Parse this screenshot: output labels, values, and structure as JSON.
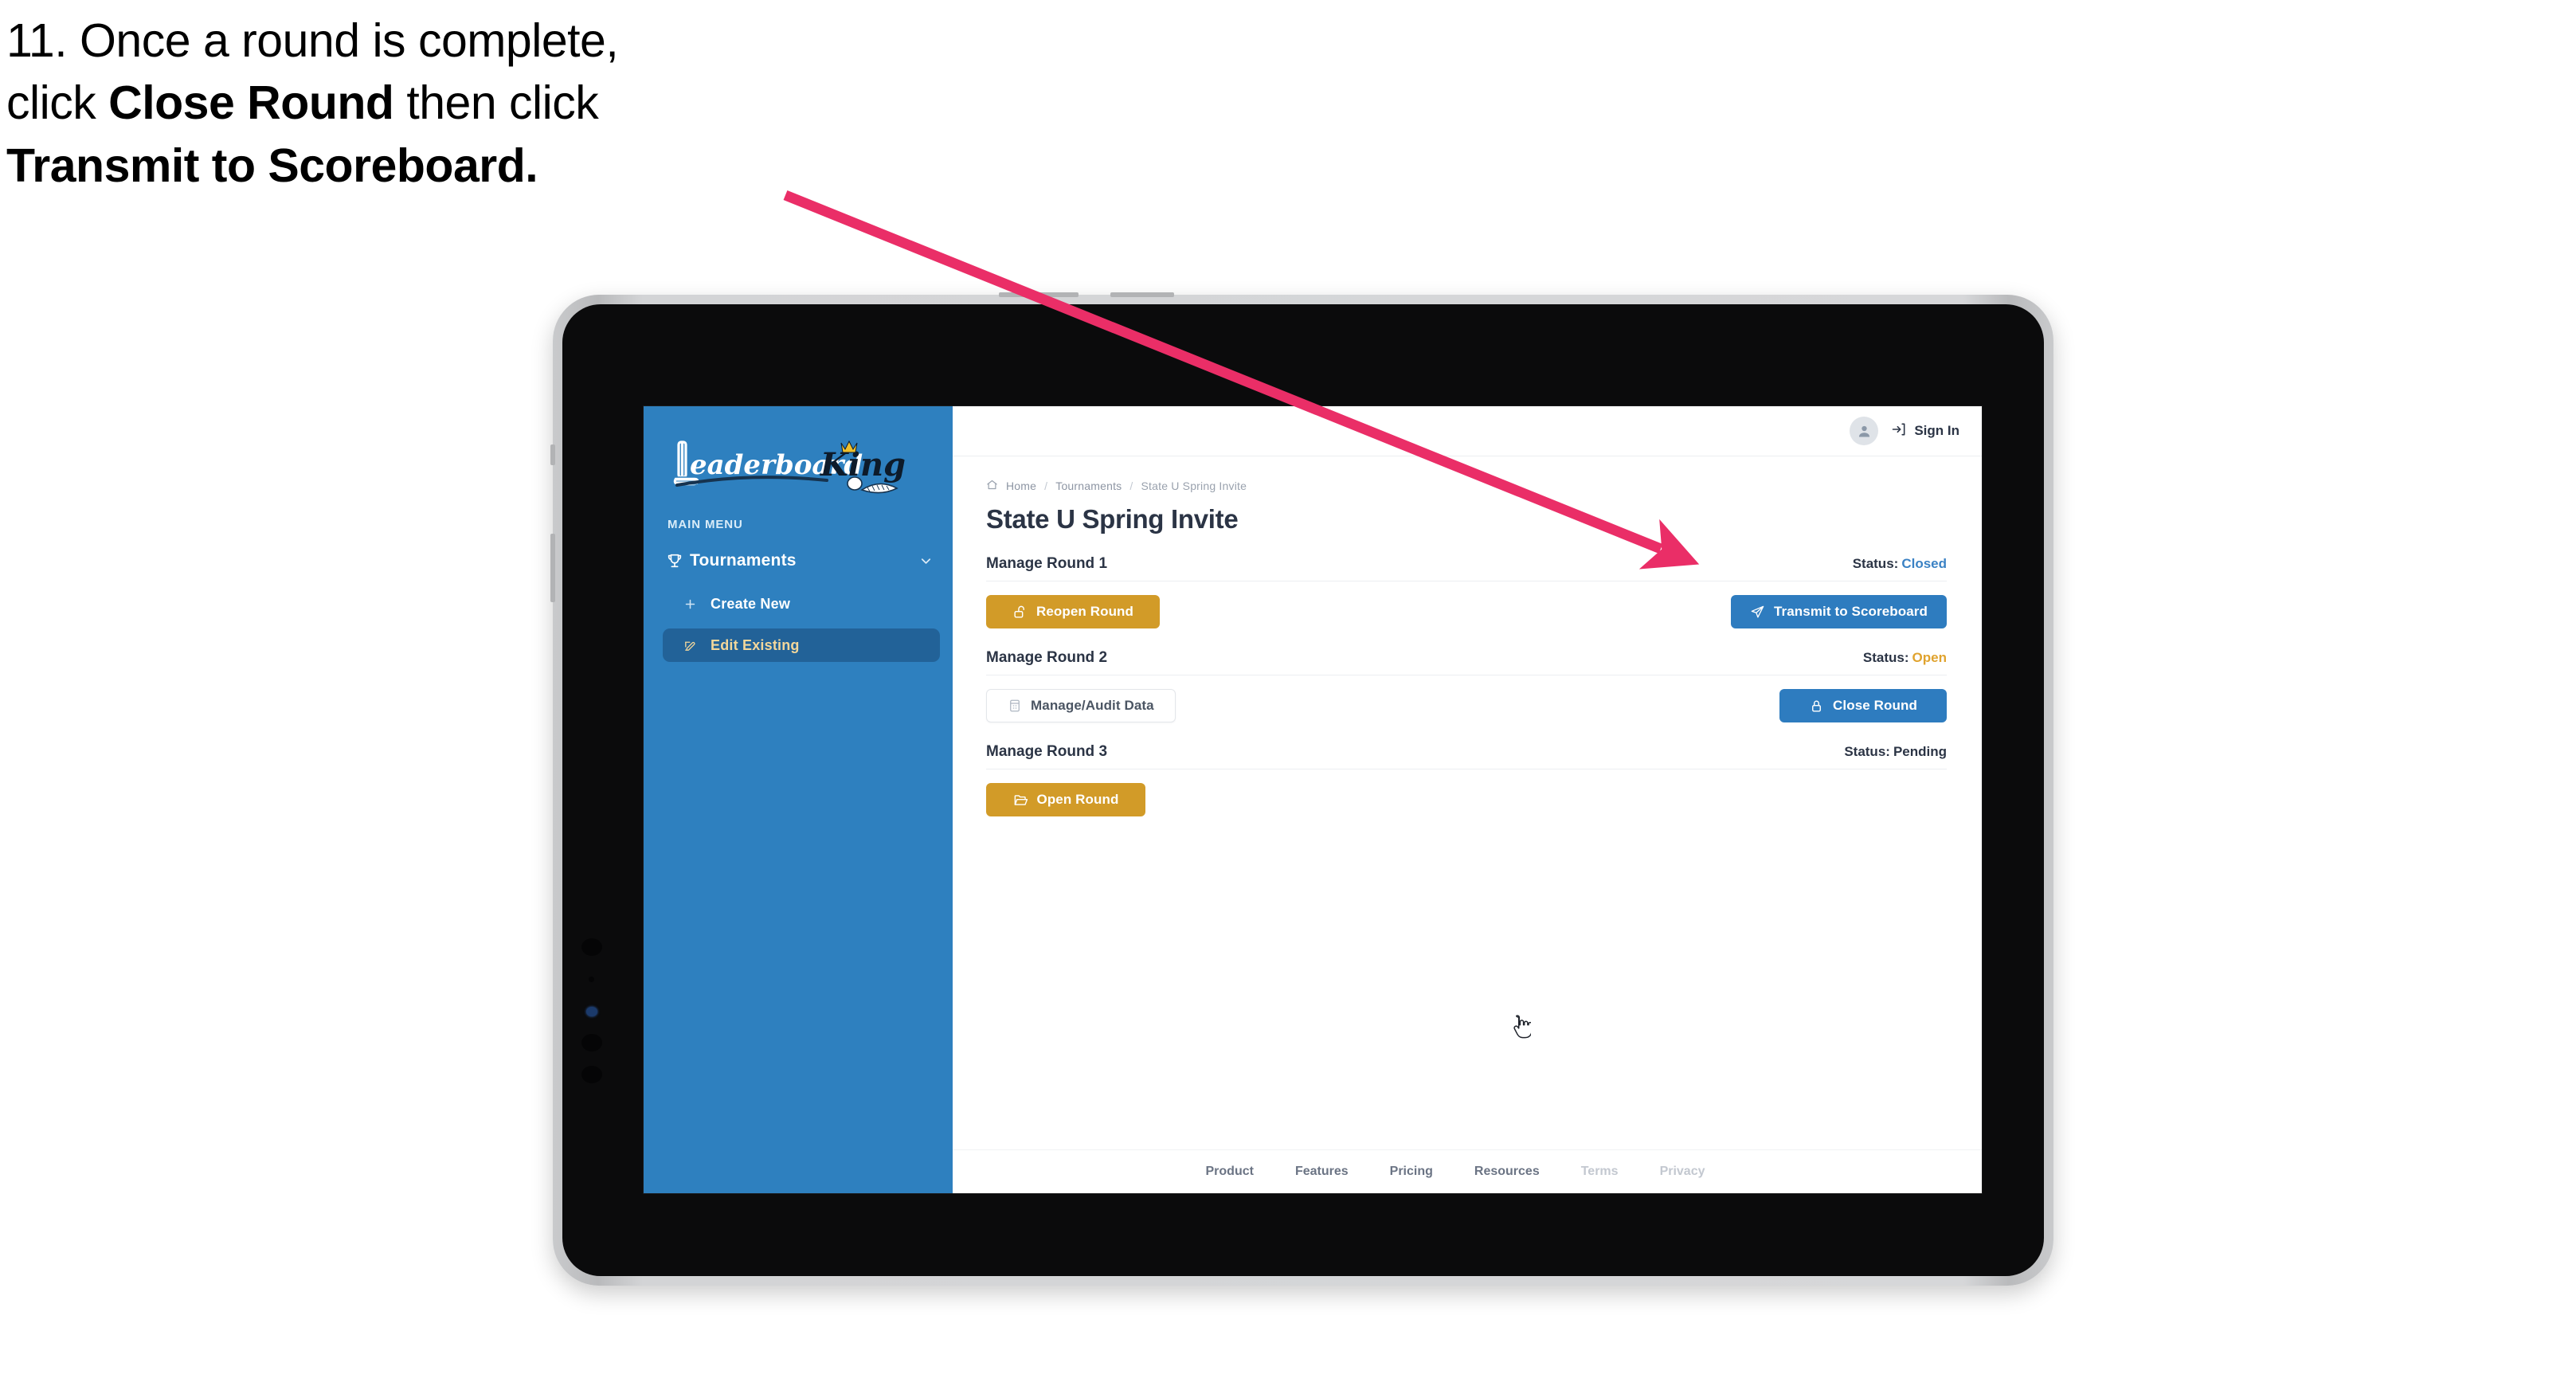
{
  "caption": {
    "line1_prefix": "11. Once a round is complete,",
    "line2_pre": "click ",
    "line2_bold": "Close Round",
    "line2_post": " then click",
    "line3_bold": "Transmit to Scoreboard."
  },
  "annotation": {
    "arrow_color": "#ea2e67",
    "arrow_name": "pointer-arrow-to-transmit-button"
  },
  "sidebar": {
    "logo": {
      "word_script": "Leaderboard",
      "word_bold": "King",
      "crown_color": "#f0c02c",
      "script_color": "#ffffff",
      "bold_color": "#0d1b2a"
    },
    "menu_label": "MAIN MENU",
    "items": [
      {
        "label": "Tournaments",
        "icon": "trophy-icon",
        "chevron": "chevron-down-icon",
        "active": false
      },
      {
        "label": "Create New",
        "icon": "plus-icon",
        "active": false
      },
      {
        "label": "Edit Existing",
        "icon": "edit-square-icon",
        "active": true
      }
    ],
    "bg_color": "#2e80bf",
    "active_bg_color": "#226298",
    "active_text_color": "#f3d79b"
  },
  "topbar": {
    "avatar_icon": "user-avatar-icon",
    "signin_icon": "login-arrow-icon",
    "signin_label": "Sign In"
  },
  "breadcrumb": {
    "home_icon": "home-icon",
    "items": [
      "Home",
      "Tournaments",
      "State U Spring Invite"
    ],
    "separator": "/"
  },
  "page": {
    "title": "State U Spring Invite"
  },
  "rounds": [
    {
      "title": "Manage Round 1",
      "status_label": "Status:",
      "status_value": "Closed",
      "status_color": "#3b82c4",
      "left_button": {
        "label": "Reopen Round",
        "icon": "unlock-icon",
        "style": "gold"
      },
      "right_button": {
        "label": "Transmit to Scoreboard",
        "icon": "paper-plane-icon",
        "style": "blue"
      }
    },
    {
      "title": "Manage Round 2",
      "status_label": "Status:",
      "status_value": "Open",
      "status_color": "#e0a32e",
      "left_button": {
        "label": "Manage/Audit Data",
        "icon": "table-grid-icon",
        "style": "ghost"
      },
      "right_button": {
        "label": "Close Round",
        "icon": "lock-icon",
        "style": "blue"
      }
    },
    {
      "title": "Manage Round 3",
      "status_label": "Status:",
      "status_value": "Pending",
      "status_color": "#2b3445",
      "left_button": {
        "label": "Open Round",
        "icon": "folder-open-icon",
        "style": "gold"
      },
      "right_button": null
    }
  ],
  "footer": {
    "links": [
      {
        "label": "Product",
        "muted": false
      },
      {
        "label": "Features",
        "muted": false
      },
      {
        "label": "Pricing",
        "muted": false
      },
      {
        "label": "Resources",
        "muted": false
      },
      {
        "label": "Terms",
        "muted": true
      },
      {
        "label": "Privacy",
        "muted": true
      }
    ]
  },
  "cursor": {
    "type": "pointing-hand-cursor"
  },
  "colors": {
    "gold_button": "#d29b28",
    "blue_button": "#2e7cbf",
    "sidebar_blue": "#2e80bf",
    "text_dark": "#2b3445",
    "arrow_pink": "#ea2e67"
  }
}
